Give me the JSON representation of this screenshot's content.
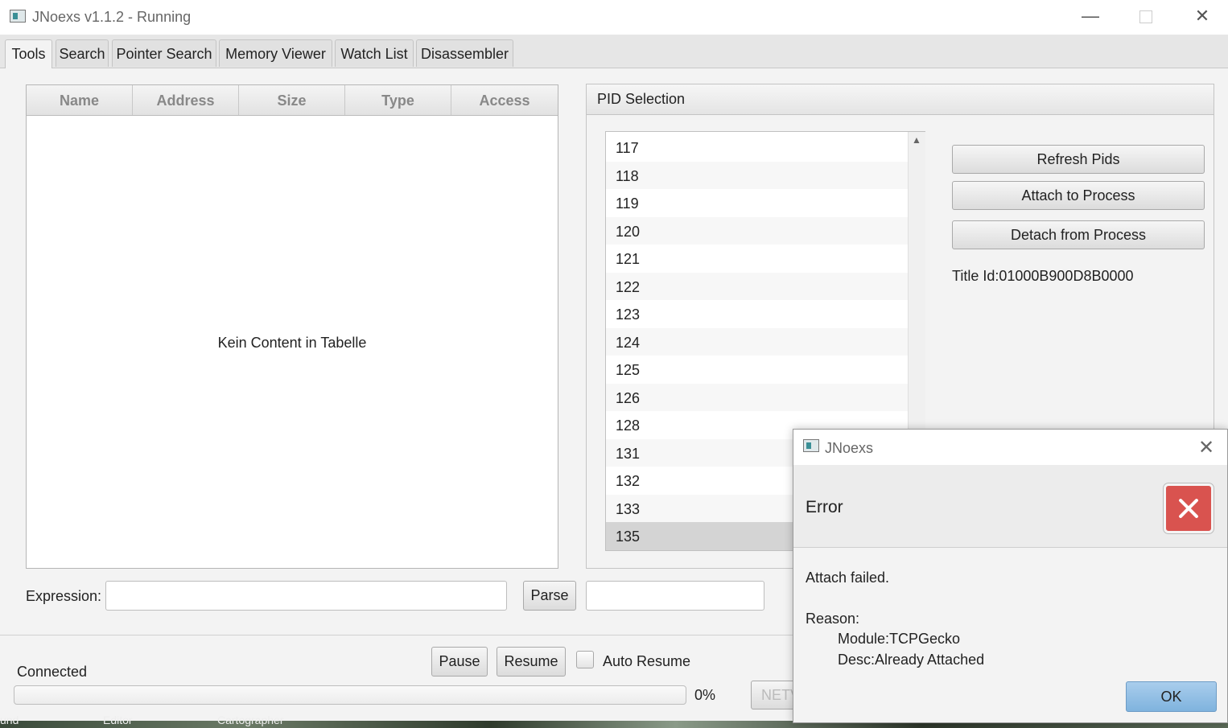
{
  "window": {
    "title": "JNoexs v1.1.2 - Running"
  },
  "tabs": [
    {
      "label": "Tools"
    },
    {
      "label": "Search"
    },
    {
      "label": "Pointer Search"
    },
    {
      "label": "Memory Viewer"
    },
    {
      "label": "Watch List"
    },
    {
      "label": "Disassembler"
    }
  ],
  "table": {
    "columns": [
      "Name",
      "Address",
      "Size",
      "Type",
      "Access"
    ],
    "empty_text": "Kein Content in Tabelle"
  },
  "pid_panel": {
    "title": "PID Selection",
    "pids": [
      "117",
      "118",
      "119",
      "120",
      "121",
      "122",
      "123",
      "124",
      "125",
      "126",
      "128",
      "131",
      "132",
      "133",
      "135"
    ],
    "selected": "135",
    "buttons": {
      "refresh": "Refresh Pids",
      "attach": "Attach to Process",
      "detach": "Detach from Process"
    },
    "title_id": "Title Id:01000B900D8B0000"
  },
  "expression": {
    "label": "Expression:",
    "value": "",
    "parse_button": "Parse",
    "result": ""
  },
  "status": {
    "connection": "Connected",
    "pause_button": "Pause",
    "resume_button": "Resume",
    "auto_resume_label": "Auto Resume",
    "auto_resume_checked": false,
    "progress": 0,
    "progress_text": "0%",
    "network_button_partial": "NETV"
  },
  "desktop_labels": [
    "und",
    "Editor",
    "Cartographer"
  ],
  "dialog": {
    "title": "JNoexs",
    "header": "Error",
    "message": "Attach failed.",
    "reason_label": "Reason:",
    "module": "Module:TCPGecko",
    "desc": "Desc:Already Attached",
    "ok_button": "OK"
  },
  "colors": {
    "accent": "#7fb3de",
    "error": "#d9534f",
    "progress": "#5c9bd6"
  }
}
